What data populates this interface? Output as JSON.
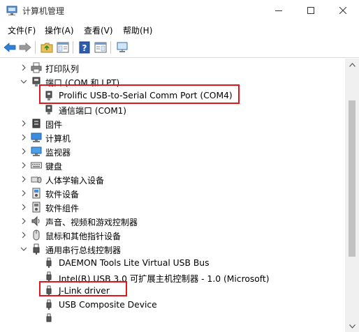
{
  "window": {
    "title": "计算机管理"
  },
  "menu": {
    "items": [
      "文件(F)",
      "操作(A)",
      "查看(V)",
      "帮助(H)"
    ]
  },
  "toolbar": {
    "buttons": [
      "back-arrow-icon",
      "forward-arrow-icon",
      "up-folder-icon",
      "show-hide-tree-icon",
      "help-icon",
      "properties-icon",
      "monitor-icon"
    ]
  },
  "tree": {
    "printers": "打印队列",
    "ports": "端口 (COM 和 LPT)",
    "port_prolific": "Prolific USB-to-Serial Comm Port (COM4)",
    "port_com1": "通信端口 (COM1)",
    "firmware": "固件",
    "computer": "计算机",
    "monitors": "监视器",
    "keyboards": "键盘",
    "hid": "人体学输入设备",
    "software_devices": "软件设备",
    "software_components": "软件组件",
    "sound": "声音、视频和游戏控制器",
    "mice": "鼠标和其他指针设备",
    "usb": "通用串行总线控制器",
    "usb_daemon": "DAEMON Tools Lite Virtual USB Bus",
    "usb_intel": "Intel(R) USB 3.0 可扩展主机控制器 - 1.0 (Microsoft)",
    "usb_jlink": "J-Link driver",
    "usb_composite": "USB Composite Device"
  },
  "highlight_color": "#e5141a"
}
